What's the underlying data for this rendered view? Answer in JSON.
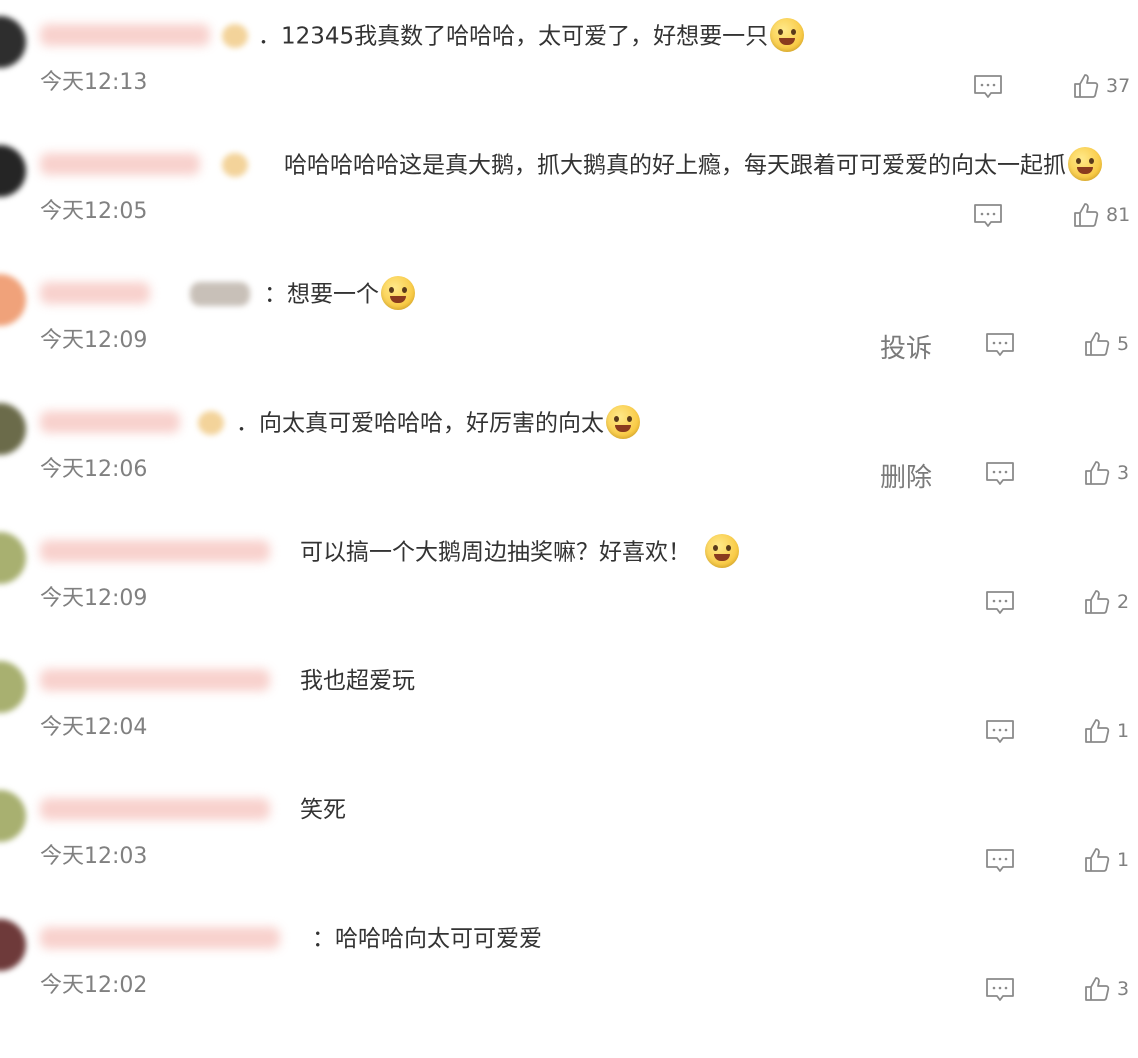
{
  "comments": [
    {
      "text": "12345我真数了哈哈哈，太可爱了，好想要一只",
      "time": "今天12:13",
      "likes": "37",
      "action": ""
    },
    {
      "text": "哈哈哈哈哈这是真大鹅，抓大鹅真的好上瘾，每天跟着可可爱爱的向太一起抓",
      "time": "今天12:05",
      "likes": "81",
      "action": ""
    },
    {
      "text": "想要一个",
      "time": "今天12:09",
      "likes": "5",
      "action": "投诉"
    },
    {
      "text": "向太真可爱哈哈哈，好厉害的向太",
      "time": "今天12:06",
      "likes": "3",
      "action": "删除"
    },
    {
      "text": "可以搞一个大鹅周边抽奖嘛？好喜欢！",
      "time": "今天12:09",
      "likes": "2",
      "action": ""
    },
    {
      "text": "我也超爱玩",
      "time": "今天12:04",
      "likes": "1",
      "action": ""
    },
    {
      "text": "笑死",
      "time": "今天12:03",
      "likes": "1",
      "action": ""
    },
    {
      "text": "哈哈哈向太可可爱爱",
      "time": "今天12:02",
      "likes": "3",
      "action": ""
    }
  ],
  "colors": {
    "text": "#333333",
    "secondary": "#808080",
    "icon": "#8a8a8a",
    "background": "#ffffff"
  },
  "icons": [
    "reply-icon",
    "thumbs-up-icon",
    "emoji-icon"
  ]
}
